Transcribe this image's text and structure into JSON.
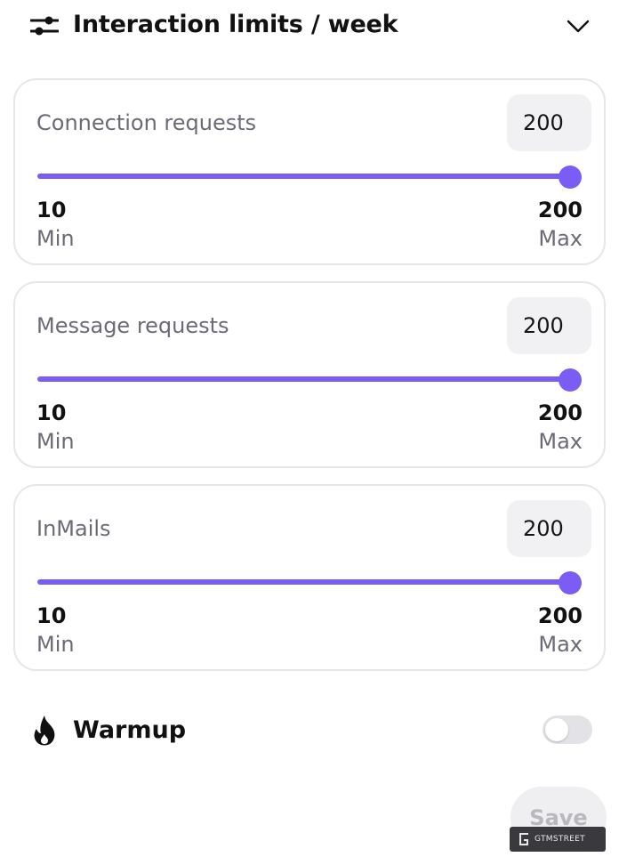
{
  "header": {
    "title": "Interaction limits / week",
    "filter_icon": "sliders-icon",
    "toggle_icon": "chevron-down-icon"
  },
  "limits": [
    {
      "label": "Connection requests",
      "value": "200",
      "min_value": "10",
      "min_label": "Min",
      "max_value": "200",
      "max_label": "Max",
      "slider_level": 1.0
    },
    {
      "label": "Message requests",
      "value": "200",
      "min_value": "10",
      "min_label": "Min",
      "max_value": "200",
      "max_label": "Max",
      "slider_level": 1.0
    },
    {
      "label": "InMails",
      "value": "200",
      "min_value": "10",
      "min_label": "Min",
      "max_value": "200",
      "max_label": "Max",
      "slider_level": 1.0
    }
  ],
  "warmup": {
    "label": "Warmup",
    "icon": "fire-icon",
    "enabled": false
  },
  "save_label": "Save",
  "watermark": {
    "text": "GTMSTREET",
    "icon": "gtmstreet-logo-icon"
  },
  "colors": {
    "accent": "#7b5cf5",
    "card_border": "#e6e6e9",
    "muted_text": "#6b6b76",
    "value_box_bg": "#f1f1f3"
  }
}
